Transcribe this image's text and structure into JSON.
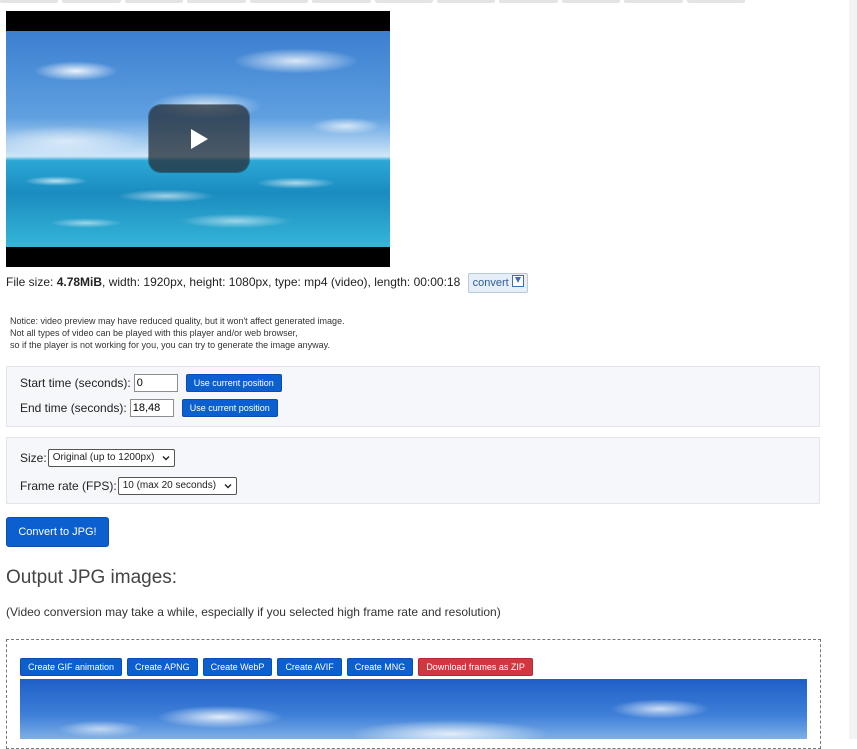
{
  "video": {
    "play_icon": "play-icon",
    "file_info": {
      "size_label": "File size: ",
      "size_value": "4.78MiB",
      "rest": ", width: 1920px, height: 1080px, type: mp4 (video), length: 00:00:18",
      "convert_label": "convert",
      "convert_icon": "download-icon"
    }
  },
  "notice": [
    "Notice: video preview may have reduced quality, but it won't affect generated image.",
    "Not all types of video can be played with this player and/or web browser,",
    "so if the player is not working for you, you can try to generate the image anyway."
  ],
  "timing": {
    "start_label": "Start time (seconds):",
    "start_value": "0",
    "end_label": "End time (seconds):",
    "end_value": "18,48",
    "use_current_label": "Use current position"
  },
  "options": {
    "size_label": "Size:",
    "size_selected": "Original (up to 1200px)",
    "fps_label": "Frame rate (FPS):",
    "fps_selected": "10 (max 20 seconds)"
  },
  "convert_button": "Convert to JPG!",
  "output": {
    "title": "Output JPG images:",
    "subtitle": "(Video conversion may take a while, especially if you selected high frame rate and resolution)",
    "actions": [
      {
        "label": "Create GIF animation",
        "color": "#0b5fcf"
      },
      {
        "label": "Create APNG",
        "color": "#0b5fcf"
      },
      {
        "label": "Create WebP",
        "color": "#0b5fcf"
      },
      {
        "label": "Create AVIF",
        "color": "#0b5fcf"
      },
      {
        "label": "Create MNG",
        "color": "#0b5fcf"
      },
      {
        "label": "Download frames as ZIP",
        "color": "#d0383f"
      }
    ]
  }
}
